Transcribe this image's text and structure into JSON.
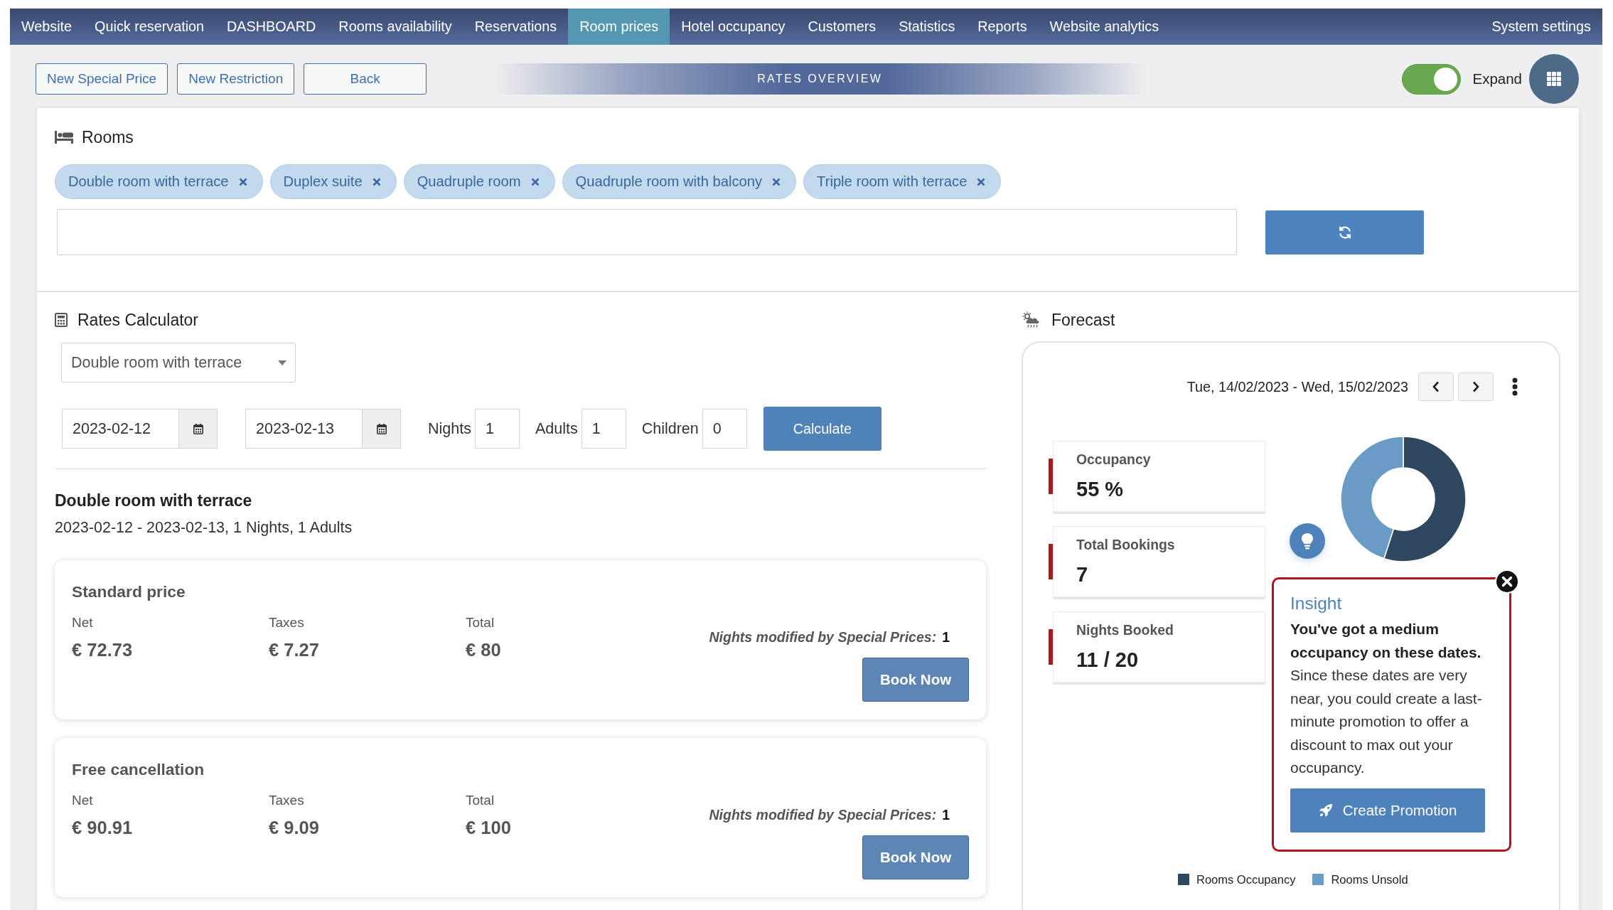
{
  "nav": {
    "items": [
      {
        "label": "Website",
        "selected": false
      },
      {
        "label": "Quick reservation",
        "selected": false
      },
      {
        "label": "DASHBOARD",
        "selected": false
      },
      {
        "label": "Rooms availability",
        "selected": false
      },
      {
        "label": "Reservations",
        "selected": false
      },
      {
        "label": "Room prices",
        "selected": true
      },
      {
        "label": "Hotel occupancy",
        "selected": false
      },
      {
        "label": "Customers",
        "selected": false
      },
      {
        "label": "Statistics",
        "selected": false
      },
      {
        "label": "Reports",
        "selected": false
      },
      {
        "label": "Website analytics",
        "selected": false
      }
    ],
    "settings": "System settings"
  },
  "toolbar": {
    "buttons": [
      "New Special Price",
      "New Restriction",
      "Back"
    ],
    "banner": "RATES OVERVIEW",
    "expand": {
      "label": "Expand",
      "on": true
    }
  },
  "rooms": {
    "title": "Rooms",
    "chips": [
      "Double room with terrace",
      "Duplex suite",
      "Quadruple room",
      "Quadruple room with balcony",
      "Triple room with terrace"
    ]
  },
  "rates_calculator": {
    "title": "Rates Calculator",
    "room": "Double room with terrace",
    "date_from": "2023-02-12",
    "date_to": "2023-02-13",
    "fields": [
      {
        "label": "Nights",
        "value": "1"
      },
      {
        "label": "Adults",
        "value": "1"
      },
      {
        "label": "Children",
        "value": "0"
      }
    ],
    "button": "Calculate"
  },
  "result": {
    "title": "Double room with terrace",
    "summary": "2023-02-12 - 2023-02-13, 1 Nights, 1 Adults",
    "offers": [
      {
        "title": "Standard price",
        "columns": [
          {
            "label": "Net",
            "value": "€ 72.73"
          },
          {
            "label": "Taxes",
            "value": "€ 7.27"
          },
          {
            "label": "Total",
            "value": "€ 80"
          }
        ],
        "note_label": "Nights modified by Special Prices:",
        "note_value": "1",
        "button": "Book Now"
      },
      {
        "title": "Free cancellation",
        "columns": [
          {
            "label": "Net",
            "value": "€ 90.91"
          },
          {
            "label": "Taxes",
            "value": "€ 9.09"
          },
          {
            "label": "Total",
            "value": "€ 100"
          }
        ],
        "note_label": "Nights modified by Special Prices:",
        "note_value": "1",
        "button": "Book Now"
      }
    ]
  },
  "forecast": {
    "title": "Forecast",
    "date_range": "Tue, 14/02/2023 - Wed, 15/02/2023",
    "stats": [
      {
        "label": "Occupancy",
        "value": "55 %"
      },
      {
        "label": "Total Bookings",
        "value": "7"
      },
      {
        "label": "Nights Booked",
        "value": "11 / 20"
      }
    ],
    "chart_data": {
      "type": "donut",
      "categories": [
        "Rooms Occupancy",
        "Rooms Unsold"
      ],
      "values": [
        55,
        45
      ],
      "colors": [
        "#2f4860",
        "#6a9bc6"
      ]
    },
    "insight": {
      "title": "Insight",
      "headline": "You've got a medium occupancy on these dates.",
      "body": "Since these dates are very near, you could create a last-minute promotion to offer a discount to max out your occupancy.",
      "button": "Create Promotion"
    }
  }
}
